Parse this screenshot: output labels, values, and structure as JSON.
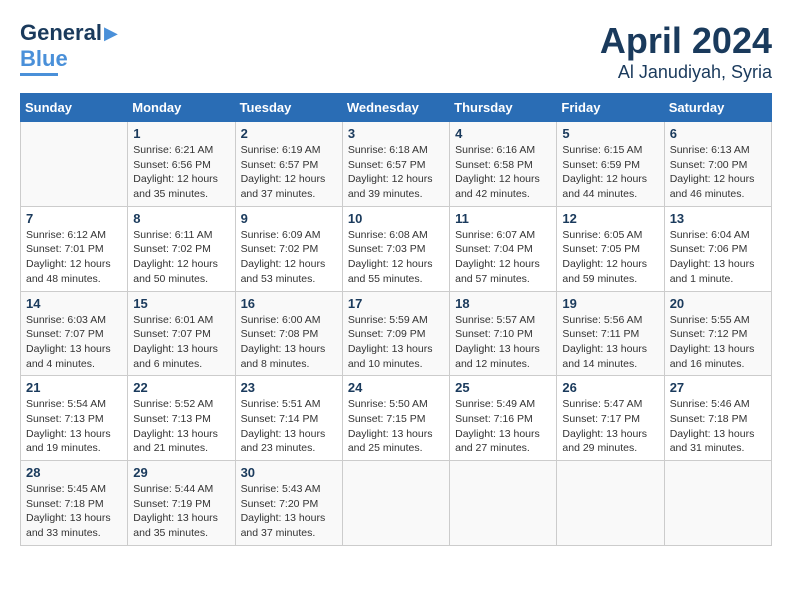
{
  "header": {
    "logo_line1": "General",
    "logo_line2": "Blue",
    "title": "April 2024",
    "subtitle": "Al Janudiyah, Syria"
  },
  "columns": [
    "Sunday",
    "Monday",
    "Tuesday",
    "Wednesday",
    "Thursday",
    "Friday",
    "Saturday"
  ],
  "weeks": [
    [
      {
        "day": "",
        "info": ""
      },
      {
        "day": "1",
        "info": "Sunrise: 6:21 AM\nSunset: 6:56 PM\nDaylight: 12 hours\nand 35 minutes."
      },
      {
        "day": "2",
        "info": "Sunrise: 6:19 AM\nSunset: 6:57 PM\nDaylight: 12 hours\nand 37 minutes."
      },
      {
        "day": "3",
        "info": "Sunrise: 6:18 AM\nSunset: 6:57 PM\nDaylight: 12 hours\nand 39 minutes."
      },
      {
        "day": "4",
        "info": "Sunrise: 6:16 AM\nSunset: 6:58 PM\nDaylight: 12 hours\nand 42 minutes."
      },
      {
        "day": "5",
        "info": "Sunrise: 6:15 AM\nSunset: 6:59 PM\nDaylight: 12 hours\nand 44 minutes."
      },
      {
        "day": "6",
        "info": "Sunrise: 6:13 AM\nSunset: 7:00 PM\nDaylight: 12 hours\nand 46 minutes."
      }
    ],
    [
      {
        "day": "7",
        "info": "Sunrise: 6:12 AM\nSunset: 7:01 PM\nDaylight: 12 hours\nand 48 minutes."
      },
      {
        "day": "8",
        "info": "Sunrise: 6:11 AM\nSunset: 7:02 PM\nDaylight: 12 hours\nand 50 minutes."
      },
      {
        "day": "9",
        "info": "Sunrise: 6:09 AM\nSunset: 7:02 PM\nDaylight: 12 hours\nand 53 minutes."
      },
      {
        "day": "10",
        "info": "Sunrise: 6:08 AM\nSunset: 7:03 PM\nDaylight: 12 hours\nand 55 minutes."
      },
      {
        "day": "11",
        "info": "Sunrise: 6:07 AM\nSunset: 7:04 PM\nDaylight: 12 hours\nand 57 minutes."
      },
      {
        "day": "12",
        "info": "Sunrise: 6:05 AM\nSunset: 7:05 PM\nDaylight: 12 hours\nand 59 minutes."
      },
      {
        "day": "13",
        "info": "Sunrise: 6:04 AM\nSunset: 7:06 PM\nDaylight: 13 hours\nand 1 minute."
      }
    ],
    [
      {
        "day": "14",
        "info": "Sunrise: 6:03 AM\nSunset: 7:07 PM\nDaylight: 13 hours\nand 4 minutes."
      },
      {
        "day": "15",
        "info": "Sunrise: 6:01 AM\nSunset: 7:07 PM\nDaylight: 13 hours\nand 6 minutes."
      },
      {
        "day": "16",
        "info": "Sunrise: 6:00 AM\nSunset: 7:08 PM\nDaylight: 13 hours\nand 8 minutes."
      },
      {
        "day": "17",
        "info": "Sunrise: 5:59 AM\nSunset: 7:09 PM\nDaylight: 13 hours\nand 10 minutes."
      },
      {
        "day": "18",
        "info": "Sunrise: 5:57 AM\nSunset: 7:10 PM\nDaylight: 13 hours\nand 12 minutes."
      },
      {
        "day": "19",
        "info": "Sunrise: 5:56 AM\nSunset: 7:11 PM\nDaylight: 13 hours\nand 14 minutes."
      },
      {
        "day": "20",
        "info": "Sunrise: 5:55 AM\nSunset: 7:12 PM\nDaylight: 13 hours\nand 16 minutes."
      }
    ],
    [
      {
        "day": "21",
        "info": "Sunrise: 5:54 AM\nSunset: 7:13 PM\nDaylight: 13 hours\nand 19 minutes."
      },
      {
        "day": "22",
        "info": "Sunrise: 5:52 AM\nSunset: 7:13 PM\nDaylight: 13 hours\nand 21 minutes."
      },
      {
        "day": "23",
        "info": "Sunrise: 5:51 AM\nSunset: 7:14 PM\nDaylight: 13 hours\nand 23 minutes."
      },
      {
        "day": "24",
        "info": "Sunrise: 5:50 AM\nSunset: 7:15 PM\nDaylight: 13 hours\nand 25 minutes."
      },
      {
        "day": "25",
        "info": "Sunrise: 5:49 AM\nSunset: 7:16 PM\nDaylight: 13 hours\nand 27 minutes."
      },
      {
        "day": "26",
        "info": "Sunrise: 5:47 AM\nSunset: 7:17 PM\nDaylight: 13 hours\nand 29 minutes."
      },
      {
        "day": "27",
        "info": "Sunrise: 5:46 AM\nSunset: 7:18 PM\nDaylight: 13 hours\nand 31 minutes."
      }
    ],
    [
      {
        "day": "28",
        "info": "Sunrise: 5:45 AM\nSunset: 7:18 PM\nDaylight: 13 hours\nand 33 minutes."
      },
      {
        "day": "29",
        "info": "Sunrise: 5:44 AM\nSunset: 7:19 PM\nDaylight: 13 hours\nand 35 minutes."
      },
      {
        "day": "30",
        "info": "Sunrise: 5:43 AM\nSunset: 7:20 PM\nDaylight: 13 hours\nand 37 minutes."
      },
      {
        "day": "",
        "info": ""
      },
      {
        "day": "",
        "info": ""
      },
      {
        "day": "",
        "info": ""
      },
      {
        "day": "",
        "info": ""
      }
    ]
  ]
}
